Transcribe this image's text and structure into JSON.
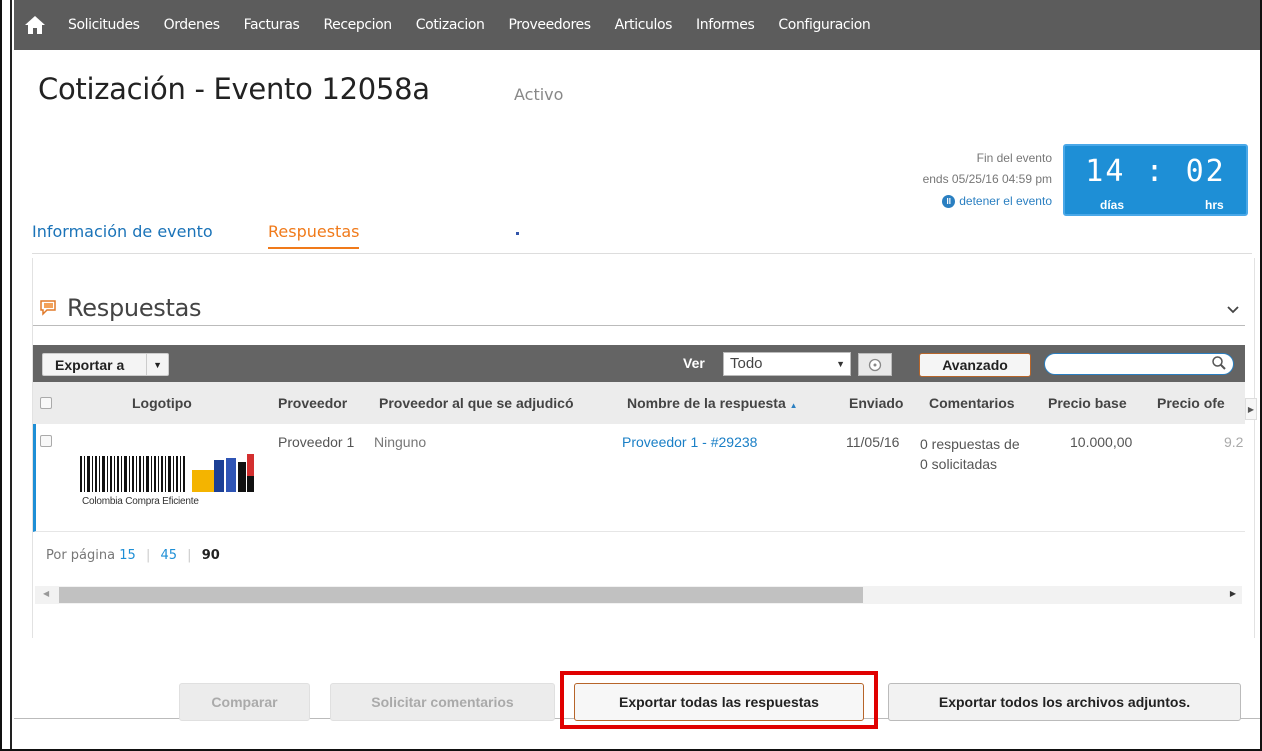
{
  "nav": {
    "items": [
      "Solicitudes",
      "Ordenes",
      "Facturas",
      "Recepcion",
      "Cotizacion",
      "Proveedores",
      "Articulos",
      "Informes",
      "Configuracion"
    ]
  },
  "page": {
    "title": "Cotización  - Evento 12058a",
    "status": "Activo"
  },
  "event_end": {
    "label": "Fin del evento",
    "ends": "ends 05/25/16 04:59 pm",
    "stop_link": "detener el evento"
  },
  "timer": {
    "days": "14",
    "separator": ":",
    "hours": "02",
    "days_label": "días",
    "hours_label": "hrs"
  },
  "tabs": {
    "info": "Información de evento",
    "responses": "Respuestas"
  },
  "section": {
    "title": "Respuestas"
  },
  "toolbar": {
    "export_label": "Exportar a",
    "view_label": "Ver",
    "view_value": "Todo",
    "advanced_label": "Avanzado",
    "search_value": ""
  },
  "table": {
    "columns": [
      "Logotipo",
      "Proveedor",
      "Proveedor al que se adjudicó",
      "Nombre de la respuesta",
      "Enviado",
      "Comentarios",
      "Precio base",
      "Precio ofe"
    ],
    "rows": [
      {
        "logo_text": "Colombia Compra Eficiente",
        "proveedor": "Proveedor 1",
        "adjudicado": "Ninguno",
        "respuesta": "Proveedor 1 - #29238",
        "enviado": "11/05/16",
        "comentarios": "0 respuestas de 0 solicitadas",
        "precio_base": "10.000,00",
        "precio_oferta": "9.2"
      }
    ]
  },
  "pagination": {
    "label": "Por página",
    "options": [
      "15",
      "45",
      "90"
    ],
    "sep": "|"
  },
  "actions": {
    "compare": "Comparar",
    "request_comments": "Solicitar comentarios",
    "export_all": "Exportar todas las respuestas",
    "export_attachments": "Exportar todos los archivos adjuntos."
  },
  "colors": {
    "nav_bg": "#5c5c5c",
    "accent_blue": "#1e8fd6",
    "tab_active": "#f07a1a",
    "highlight": "#e00000"
  }
}
